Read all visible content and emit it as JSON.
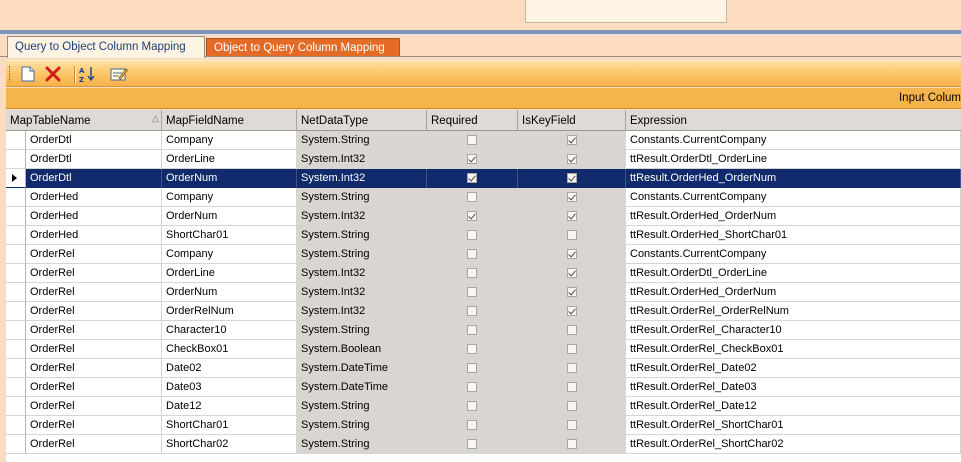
{
  "tabs": [
    {
      "label": "Query to Object Column Mapping"
    },
    {
      "label": "Object to Query Column Mapping"
    }
  ],
  "toolbar": {
    "icons": [
      "new-document-icon",
      "delete-icon",
      "sort-az-icon",
      "edit-properties-icon"
    ]
  },
  "group_band": {
    "label": "Input Colum"
  },
  "grid": {
    "columns": [
      "MapTableName",
      "MapFieldName",
      "NetDataType",
      "Required",
      "IsKeyField",
      "Expression"
    ],
    "rows": [
      {
        "table": "OrderDtl",
        "field": "Company",
        "type": "System.String",
        "required": false,
        "key": true,
        "expr": "Constants.CurrentCompany"
      },
      {
        "table": "OrderDtl",
        "field": "OrderLine",
        "type": "System.Int32",
        "required": true,
        "key": true,
        "expr": "ttResult.OrderDtl_OrderLine"
      },
      {
        "table": "OrderDtl",
        "field": "OrderNum",
        "type": "System.Int32",
        "required": true,
        "key": true,
        "expr": "ttResult.OrderHed_OrderNum"
      },
      {
        "table": "OrderHed",
        "field": "Company",
        "type": "System.String",
        "required": false,
        "key": true,
        "expr": "Constants.CurrentCompany"
      },
      {
        "table": "OrderHed",
        "field": "OrderNum",
        "type": "System.Int32",
        "required": true,
        "key": true,
        "expr": "ttResult.OrderHed_OrderNum"
      },
      {
        "table": "OrderHed",
        "field": "ShortChar01",
        "type": "System.String",
        "required": false,
        "key": false,
        "expr": "ttResult.OrderHed_ShortChar01"
      },
      {
        "table": "OrderRel",
        "field": "Company",
        "type": "System.String",
        "required": false,
        "key": true,
        "expr": "Constants.CurrentCompany"
      },
      {
        "table": "OrderRel",
        "field": "OrderLine",
        "type": "System.Int32",
        "required": false,
        "key": true,
        "expr": "ttResult.OrderDtl_OrderLine"
      },
      {
        "table": "OrderRel",
        "field": "OrderNum",
        "type": "System.Int32",
        "required": false,
        "key": true,
        "expr": "ttResult.OrderHed_OrderNum"
      },
      {
        "table": "OrderRel",
        "field": "OrderRelNum",
        "type": "System.Int32",
        "required": false,
        "key": true,
        "expr": "ttResult.OrderRel_OrderRelNum"
      },
      {
        "table": "OrderRel",
        "field": "Character10",
        "type": "System.String",
        "required": false,
        "key": false,
        "expr": "ttResult.OrderRel_Character10"
      },
      {
        "table": "OrderRel",
        "field": "CheckBox01",
        "type": "System.Boolean",
        "required": false,
        "key": false,
        "expr": "ttResult.OrderRel_CheckBox01"
      },
      {
        "table": "OrderRel",
        "field": "Date02",
        "type": "System.DateTime",
        "required": false,
        "key": false,
        "expr": "ttResult.OrderRel_Date02"
      },
      {
        "table": "OrderRel",
        "field": "Date03",
        "type": "System.DateTime",
        "required": false,
        "key": false,
        "expr": "ttResult.OrderRel_Date03"
      },
      {
        "table": "OrderRel",
        "field": "Date12",
        "type": "System.String",
        "required": false,
        "key": false,
        "expr": "ttResult.OrderRel_Date12"
      },
      {
        "table": "OrderRel",
        "field": "ShortChar01",
        "type": "System.String",
        "required": false,
        "key": false,
        "expr": "ttResult.OrderRel_ShortChar01"
      },
      {
        "table": "OrderRel",
        "field": "ShortChar02",
        "type": "System.String",
        "required": false,
        "key": false,
        "expr": "ttResult.OrderRel_ShortChar02"
      }
    ],
    "selected_row": 2
  }
}
